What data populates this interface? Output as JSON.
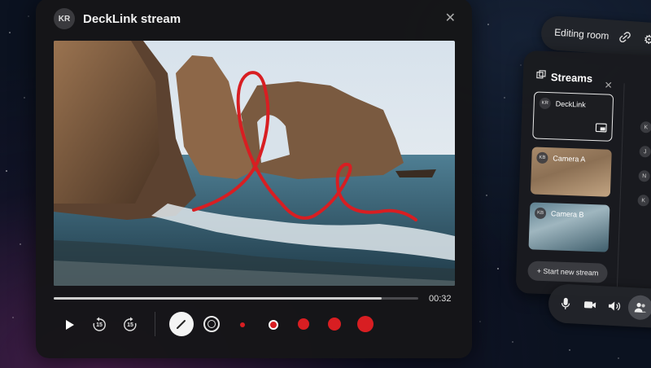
{
  "player": {
    "avatar": "KR",
    "title": "DeckLink stream",
    "progress_fraction": 0.9,
    "time": "00:32",
    "controls": {
      "play_icon": "play-icon",
      "rewind_icon": "rewind-15-icon",
      "forward_icon": "forward-15-icon",
      "skip_seconds": "15",
      "pen_icon": "pen-icon",
      "target_icon": "target-icon"
    },
    "annotation_color": "#d81e22",
    "brush_sizes": [
      "xs",
      "s",
      "m",
      "l",
      "xl"
    ]
  },
  "editing_room": {
    "label": "Editing room",
    "link_icon": "link-icon",
    "settings_icon": "gear-icon"
  },
  "streams_panel": {
    "title": "Streams",
    "streams": [
      {
        "avatar": "KR",
        "name": "DeckLink",
        "selected": true
      },
      {
        "avatar": "KB",
        "name": "Camera A",
        "selected": false
      },
      {
        "avatar": "KB",
        "name": "Camera B",
        "selected": false
      }
    ],
    "new_stream_label": "+ Start new stream",
    "participants": [
      "K",
      "J",
      "N",
      "K"
    ]
  },
  "media_controls": {
    "icons": [
      "microphone-icon",
      "camera-icon",
      "speaker-icon",
      "participants-icon"
    ]
  }
}
